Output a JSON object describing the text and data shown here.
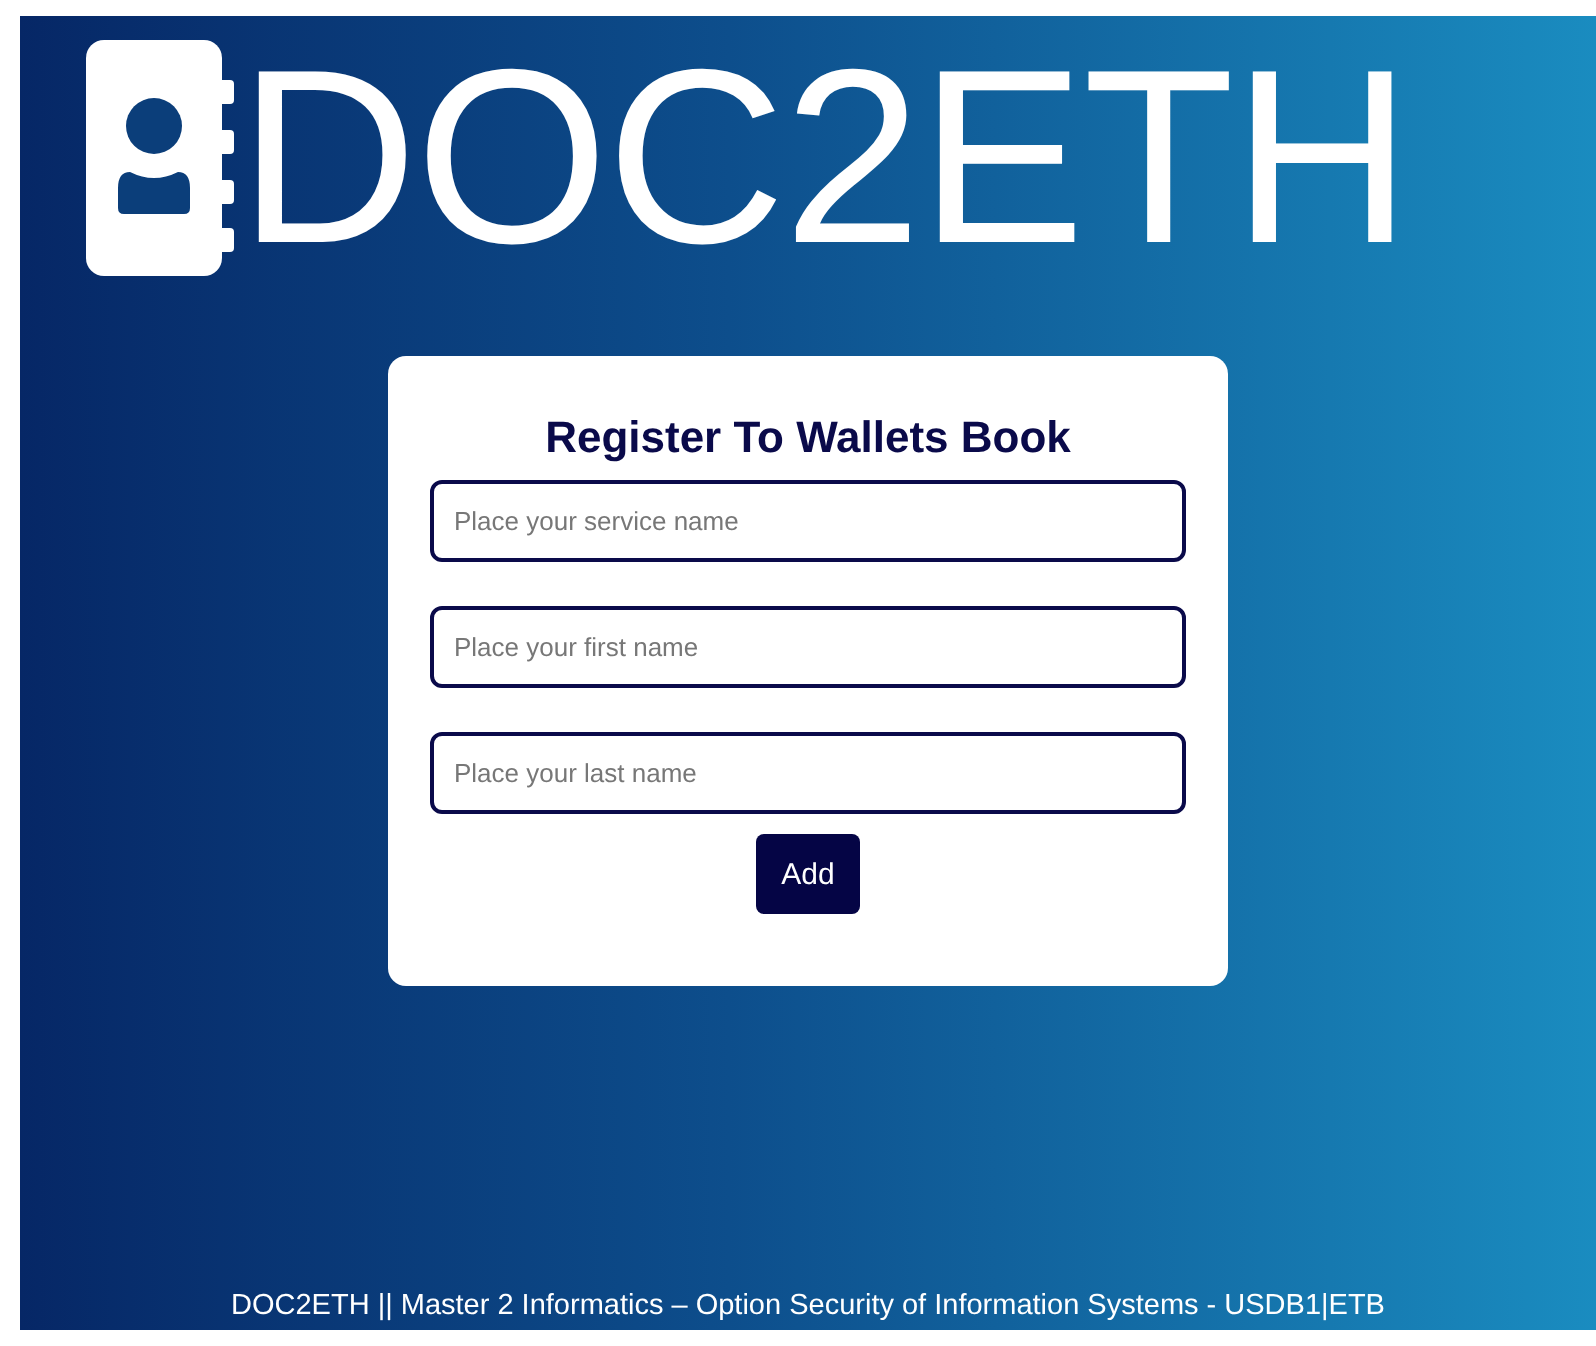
{
  "brand": {
    "name": "DOC2ETH"
  },
  "form": {
    "title": "Register To Wallets Book",
    "fields": [
      {
        "placeholder": "Place your service name"
      },
      {
        "placeholder": "Place your first name"
      },
      {
        "placeholder": "Place your last name"
      }
    ],
    "submit": "Add"
  },
  "footer": "DOC2ETH || Master 2 Informatics – Option Security of Information Systems - USDB1|ETB"
}
